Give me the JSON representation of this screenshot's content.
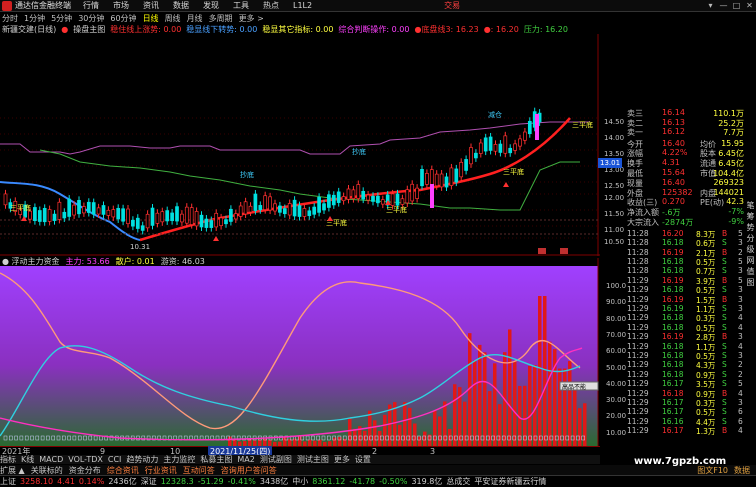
{
  "app": {
    "title": "通达信金融终端",
    "trade": "交易"
  },
  "menu": [
    "行情",
    "市场",
    "资讯",
    "数据",
    "发现",
    "工具",
    "热点",
    "L1L2"
  ],
  "window_ctrls": [
    "▾",
    "—",
    "□",
    "✕"
  ],
  "periods": [
    "分时",
    "1分钟",
    "5分钟",
    "30分钟",
    "60分钟",
    "日线",
    "周线",
    "月线",
    "多周期",
    "更多 >"
  ],
  "active_period": "日线",
  "indicator_header": [
    {
      "text": "新疆交建(日线)",
      "color": "#d0d0d0"
    },
    {
      "text": "●",
      "color": "#ff3030"
    },
    {
      "text": "操盘主图",
      "color": "#d0d0d0"
    },
    {
      "text": "稳住线上涨势: 0.00",
      "color": "#ff3030"
    },
    {
      "text": "稳显线下转势: 0.00",
      "color": "#4aa0ff"
    },
    {
      "text": "稳显其它指标: 0.00",
      "color": "#ffff40"
    },
    {
      "text": "综合判断操作: 0.00",
      "color": "#ff40ff"
    },
    {
      "text": "●底盘线3: 16.23",
      "color": "#ff3030"
    },
    {
      "text": "●: 16.20",
      "color": "#ff3030"
    },
    {
      "text": "压力: 16.20",
      "color": "#40d040"
    }
  ],
  "price_axis": [
    "14.50",
    "14.00",
    "13.50",
    "13.00",
    "12.50",
    "12.00",
    "11.50",
    "11.00",
    "10.50"
  ],
  "current_price": "13.01",
  "lower_axis": [
    "100.00",
    "90.00",
    "80.00",
    "70.00",
    "60.00",
    "50.00",
    "40.00",
    "30.00",
    "20.00",
    "10.00"
  ],
  "sub_header": [
    {
      "text": "● 浮动主力资金",
      "color": "#d0d0d0"
    },
    {
      "text": "主力: 53.66",
      "color": "#ff40ff"
    },
    {
      "text": "散户: 0.01",
      "color": "#ffff40"
    },
    {
      "text": "游资: 46.03",
      "color": "#d0d0d0"
    }
  ],
  "main_annotations": [
    {
      "text": "三平底",
      "color": "#ffff40"
    },
    {
      "text": "三平底",
      "color": "#ffff40"
    },
    {
      "text": "三平底",
      "color": "#ffff40"
    },
    {
      "text": "三平底",
      "color": "#ffff40"
    },
    {
      "text": "三平底",
      "color": "#ffff40"
    },
    {
      "text": "10.31",
      "color": "#d0d0d0"
    },
    {
      "text": "抄底",
      "color": "#40d0ff"
    },
    {
      "text": "抄底",
      "color": "#40d0ff"
    },
    {
      "text": "减仓",
      "color": "#40d0ff"
    }
  ],
  "axis_dates": [
    "2021年",
    "9",
    "10",
    "2021/11/25(四)",
    "2",
    "3"
  ],
  "quote": {
    "asks": [
      {
        "label": "卖三",
        "price": "16.14",
        "vol": "110.1万"
      },
      {
        "label": "卖二",
        "price": "16.13",
        "vol": "25.2万"
      },
      {
        "label": "卖一",
        "price": "16.12",
        "vol": "7.7万"
      }
    ],
    "fields": [
      {
        "l1": "今开",
        "v1": "16.40",
        "l2": "均价",
        "v2": "15.95"
      },
      {
        "l1": "涨幅",
        "v1": "4.22%",
        "l2": "股本",
        "v2": "6.45亿"
      },
      {
        "l1": "换手",
        "v1": "4.31",
        "l2": "流通",
        "v2": "6.45亿"
      },
      {
        "l1": "最低",
        "v1": "15.64",
        "l2": "市值",
        "v2": "104.4亿"
      },
      {
        "l1": "现量",
        "v1": "16.40",
        "l2": "",
        "v2": "269323"
      },
      {
        "l1": "外盘",
        "v1": "125382",
        "l2": "内盘",
        "v2": "144021"
      },
      {
        "l1": "收益(三)",
        "v1": "0.270",
        "l2": "PE(动)",
        "v2": "42.3"
      },
      {
        "l1": "净流入额",
        "v1": "-.6万",
        "l2": "",
        "v2": "-7%"
      },
      {
        "l1": "大宗流入",
        "v1": "-2874万",
        "l2": "",
        "v2": "-9%"
      }
    ],
    "ticks": [
      {
        "time": "11:28",
        "price": "16.20",
        "vol": "8.3万",
        "bs": "B",
        "n": "5"
      },
      {
        "time": "11:28",
        "price": "16.18",
        "vol": "0.6万",
        "bs": "S",
        "n": "3"
      },
      {
        "time": "11:28",
        "price": "16.19",
        "vol": "2.1万",
        "bs": "B",
        "n": "2"
      },
      {
        "time": "11:28",
        "price": "16.18",
        "vol": "0.5万",
        "bs": "S",
        "n": "5"
      },
      {
        "time": "11:28",
        "price": "16.18",
        "vol": "0.7万",
        "bs": "S",
        "n": "3"
      },
      {
        "time": "11:29",
        "price": "16.19",
        "vol": "3.9万",
        "bs": "B",
        "n": "5"
      },
      {
        "time": "11:29",
        "price": "16.18",
        "vol": "0.5万",
        "bs": "S",
        "n": "3"
      },
      {
        "time": "11:29",
        "price": "16.19",
        "vol": "1.5万",
        "bs": "B",
        "n": "3"
      },
      {
        "time": "11:29",
        "price": "16.19",
        "vol": "1.1万",
        "bs": "S",
        "n": "3"
      },
      {
        "time": "11:29",
        "price": "16.18",
        "vol": "0.3万",
        "bs": "S",
        "n": "4"
      },
      {
        "time": "11:29",
        "price": "16.18",
        "vol": "0.5万",
        "bs": "S",
        "n": "4"
      },
      {
        "time": "11:29",
        "price": "16.19",
        "vol": "2.8万",
        "bs": "B",
        "n": "3"
      },
      {
        "time": "11:29",
        "price": "16.18",
        "vol": "1.1万",
        "bs": "S",
        "n": "4"
      },
      {
        "time": "11:29",
        "price": "16.18",
        "vol": "0.5万",
        "bs": "S",
        "n": "3"
      },
      {
        "time": "11:29",
        "price": "16.18",
        "vol": "4.3万",
        "bs": "S",
        "n": "2"
      },
      {
        "time": "11:29",
        "price": "16.18",
        "vol": "0.9万",
        "bs": "S",
        "n": "2"
      },
      {
        "time": "11:29",
        "price": "16.17",
        "vol": "3.5万",
        "bs": "S",
        "n": "5"
      },
      {
        "time": "11:29",
        "price": "16.18",
        "vol": "0.9万",
        "bs": "B",
        "n": "4"
      },
      {
        "time": "11:29",
        "price": "16.17",
        "vol": "0.3万",
        "bs": "S",
        "n": "3"
      },
      {
        "time": "11:29",
        "price": "16.17",
        "vol": "0.5万",
        "bs": "S",
        "n": "6"
      },
      {
        "time": "11:29",
        "price": "16.16",
        "vol": "4.4万",
        "bs": "S",
        "n": "6"
      },
      {
        "time": "11:29",
        "price": "16.17",
        "vol": "1.3万",
        "bs": "B",
        "n": "4"
      }
    ]
  },
  "tabs1": [
    "指标",
    "K线",
    "MACD",
    "VOL-TDX",
    "CCI",
    "趋势动力",
    "主力监控",
    "私募主图",
    "MA2",
    "测试副图",
    "测试主图",
    "更多",
    "设置"
  ],
  "tabs2": [
    "扩展 ▲",
    "关联标的",
    "资金分布",
    "综合资讯",
    "行业资讯",
    "互动问答",
    "咨询用户答问答"
  ],
  "tabs2_right": [
    "图文F10",
    "数据"
  ],
  "side_tabs": [
    "笔",
    "筹",
    "势",
    "分",
    "级",
    "网",
    "值",
    "图"
  ],
  "tooltip": "高品不能",
  "watermark": "www.7gpzb.com",
  "status": [
    {
      "text": "上证",
      "color": "#d0d0d0"
    },
    {
      "text": "3258.10",
      "color": "#ff3030"
    },
    {
      "text": "4.41",
      "color": "#ff3030"
    },
    {
      "text": "0.14%",
      "color": "#ff3030"
    },
    {
      "text": "2436亿",
      "color": "#d0d0d0"
    },
    {
      "text": "深证",
      "color": "#d0d0d0"
    },
    {
      "text": "12328.3",
      "color": "#40d040"
    },
    {
      "text": "-51.29",
      "color": "#40d040"
    },
    {
      "text": "-0.41%",
      "color": "#40d040"
    },
    {
      "text": "3438亿",
      "color": "#d0d0d0"
    },
    {
      "text": "中小",
      "color": "#d0d0d0"
    },
    {
      "text": "8361.12",
      "color": "#40d040"
    },
    {
      "text": "-41.78",
      "color": "#40d040"
    },
    {
      "text": "-0.50%",
      "color": "#40d040"
    },
    {
      "text": "319.8亿",
      "color": "#d0d0d0"
    },
    {
      "text": "总成交",
      "color": "#d0d0d0"
    },
    {
      "text": "平安证券新疆云行情",
      "color": "#d0d0d0"
    }
  ]
}
